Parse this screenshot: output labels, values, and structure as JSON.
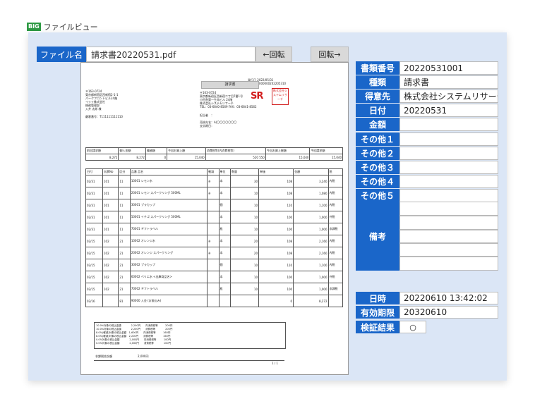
{
  "window": {
    "badge": "BIG",
    "title": "ファイルビュー"
  },
  "file": {
    "label": "ファイル名",
    "name": "請求書20220531.pdf"
  },
  "rotate": {
    "left": "←回転",
    "right": "回転→"
  },
  "fields": [
    {
      "label": "書類番号",
      "value": "20220531001"
    },
    {
      "label": "種類",
      "value": "請求書"
    },
    {
      "label": "得意先",
      "value": "株式会社システムリサーチ"
    },
    {
      "label": "日付",
      "value": "20220531"
    },
    {
      "label": "金額",
      "value": ""
    },
    {
      "label": "その他１",
      "value": ""
    },
    {
      "label": "その他２",
      "value": ""
    },
    {
      "label": "その他３",
      "value": ""
    },
    {
      "label": "その他４",
      "value": ""
    },
    {
      "label": "その他５",
      "value": ""
    }
  ],
  "remarks": {
    "label": "備考",
    "lines": [
      "",
      "",
      "",
      "",
      ""
    ]
  },
  "meta": [
    {
      "label": "日時",
      "value": "20220610 13:42:02"
    },
    {
      "label": "有効期限",
      "value": "20320610"
    },
    {
      "label": "検証結果",
      "value": "○"
    }
  ],
  "invoice": {
    "title": "請求書",
    "issue_date": "発行日 2022/05/31",
    "invoice_no": "請求No. 000000202205310",
    "recipient": [
      "〒163-0724",
      "東京都新宿区西新宿2-1-1",
      "パークフロントビル24階",
      "イリイ株式会社",
      "総務管理部",
      "入井 太郎 様"
    ],
    "customer_no": "顧客番号：T111111111110",
    "issuer": [
      "〒163-0724",
      "東京都新宿区西新宿二丁目7番1号",
      "小田急第一生命ビル 24階",
      "株式会社システムリサーチ",
      "TEL：03-6840-8569 FAX：03-6841-8562"
    ],
    "pic": "担当者　：",
    "contract": "売掛先名：A)〇〇〇〇〇〇〇",
    "period": "支払期日：",
    "sr_logo": "SR",
    "stamp": "株式会社システムリサーチ",
    "summary_headers": [
      "前回請求額",
      "御入金額",
      "繰越額",
      "今回お買上額",
      "消費税等(内消費税等)",
      "今回お買上総額",
      "今回請求額"
    ],
    "summary_values": [
      "8,272",
      "8,272",
      "0",
      "15,040",
      "",
      "15,040",
      "15,040"
    ],
    "tax_sub": [
      "520",
      "550"
    ],
    "detail_headers": [
      "日付",
      "伝票No",
      "区分",
      "品番 品名",
      "軽減",
      "単位",
      "数量",
      "単価",
      "金額",
      "税"
    ],
    "rows": [
      [
        "02/31",
        "101",
        "11",
        "10001 レモン水",
        "※",
        "本",
        "30",
        "108",
        "3,240",
        "内税"
      ],
      [
        "02/31",
        "101",
        "11",
        "20001 レモン スパークリング 500ML",
        "※",
        "本",
        "10",
        "108",
        "1,080",
        "内税"
      ],
      [
        "02/31",
        "101",
        "11",
        "30001 プラカップ",
        "",
        "個",
        "10",
        "110",
        "1,100",
        "内税"
      ],
      [
        "02/31",
        "101",
        "11",
        "50001 イチゴ スパークリング 500ML",
        "",
        "本",
        "10",
        "100",
        "1,000",
        "外税"
      ],
      [
        "02/31",
        "101",
        "11",
        "70001 ギフトラベル",
        "",
        "枚",
        "10",
        "100",
        "1,000",
        "非課税"
      ],
      [
        "02/15",
        "102",
        "21",
        "10002 オレンジ水",
        "※",
        "本",
        "20",
        "108",
        "2,160",
        "内税"
      ],
      [
        "02/15",
        "102",
        "21",
        "20002 オレンジ スパークリング",
        "※",
        "本",
        "20",
        "108",
        "2,160",
        "内税"
      ],
      [
        "02/15",
        "102",
        "21",
        "30002 プラカップ",
        "",
        "個",
        "10",
        "110",
        "1,100",
        "内税"
      ],
      [
        "02/15",
        "102",
        "21",
        "60002 ペリエ水 <出庫商品名>",
        "",
        "本",
        "10",
        "100",
        "1,000",
        "外税"
      ],
      [
        "02/15",
        "102",
        "21",
        "70002 ギフトラベル",
        "",
        "枚",
        "10",
        "100",
        "1,000",
        "非課税"
      ],
      [
        "02/16",
        "",
        "81",
        "90000 入金 (お振込み)",
        "",
        "",
        "",
        "0",
        "8,272",
        ""
      ]
    ],
    "tax_lines": [
      "10.0%対象の税込金額　　　　2,200円　　内消費税等　　　200円",
      "10.0%対象の税込金額　　　　2,200円　　消費税等　　　　200円",
      "8.0%(軽減)対象の税込金額　1,600円　　内消費税等　　　160円",
      "8.0%(軽減)対象の税込金額　2,200円　　消費税等　　　　160円",
      "0.0%対象の税込金額　　　　2,000円　　内消費税等　　　100円",
      "0.0%対象の税込金額　　　　2,000円　　消費税等　　　　100円"
    ],
    "non_taxable": "非課税合計額　　　　　　　　　2,000円",
    "page": "1 / 1"
  }
}
